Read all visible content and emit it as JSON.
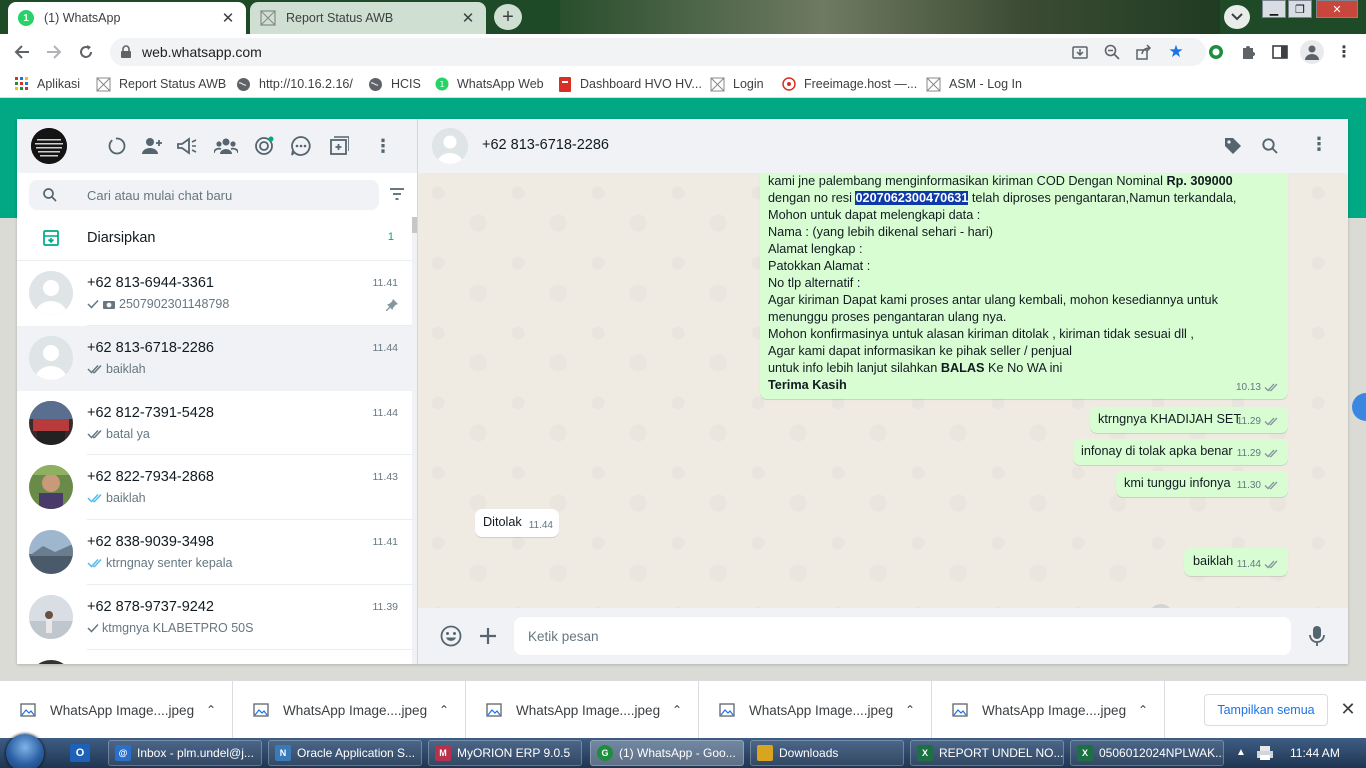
{
  "browser": {
    "tabs": [
      {
        "title": "(1) WhatsApp",
        "badge": "1"
      },
      {
        "title": "Report Status AWB"
      }
    ],
    "url": "web.whatsapp.com",
    "bookmarks": [
      "Aplikasi",
      "Report Status AWB",
      "http://10.16.2.16/",
      "HCIS",
      "WhatsApp Web",
      "Dashboard HVO HV...",
      "Login",
      "Freeimage.host —...",
      "ASM - Log In"
    ]
  },
  "sidebar": {
    "search_placeholder": "Cari atau mulai chat baru",
    "archived_label": "Diarsipkan",
    "archived_count": "1",
    "chats": [
      {
        "name": "+62 813-6944-3361",
        "time": "11.41",
        "preview": "2507902301148798",
        "check": "single",
        "has_photo_icon": true,
        "pinned": true
      },
      {
        "name": "+62 813-6718-2286",
        "time": "11.44",
        "preview": "baiklah",
        "check": "double",
        "selected": true
      },
      {
        "name": "+62 812-7391-5428",
        "time": "11.44",
        "preview": "batal ya",
        "check": "double"
      },
      {
        "name": "+62 822-7934-2868",
        "time": "11.43",
        "preview": "baiklah",
        "check": "double-blue"
      },
      {
        "name": "+62 838-9039-3498",
        "time": "11.41",
        "preview": "ktrngnay senter kepala",
        "check": "double-blue"
      },
      {
        "name": "+62 878-9737-9242",
        "time": "11.39",
        "preview": "ktmgnya KLABETPRO 50S",
        "check": "single"
      }
    ]
  },
  "conversation": {
    "contact": "+62 813-6718-2286",
    "big_message": {
      "line1_prefix": "kami jne palembang menginformasikan kiriman  COD Dengan Nominal ",
      "line1_bold": "Rp. 309000",
      "line2_prefix": "dengan no resi ",
      "line2_highlight": "0207062300470631",
      "line2_suffix": " telah diproses pengantaran,Namun terkandala,",
      "lines": [
        "Mohon untuk dapat melengkapi data :",
        "Nama : (yang lebih dikenal sehari - hari)",
        "Alamat  lengkap :",
        "Patokkan Alamat :",
        "No tlp alternatif :",
        "Agar kiriman Dapat kami proses antar ulang kembali, mohon kesediannya untuk",
        "menunggu proses pengantaran ulang nya.",
        "Mohon konfirmasinya untuk alasan kiriman ditolak , kiriman tidak sesuai dll ,",
        "Agar kami dapat informasikan ke pihak seller / penjual"
      ],
      "line_last_prefix": "untuk info lebih lanjut silahkan ",
      "line_last_bold": "BALAS",
      "line_last_suffix": " Ke No WA ini",
      "closing": "Terima Kasih",
      "time": "10.13"
    },
    "messages": [
      {
        "dir": "out",
        "text": "ktrngnya KHADIJAH SET",
        "time": "11.29"
      },
      {
        "dir": "out",
        "text": "infonay di tolak apka benar",
        "time": "11.29"
      },
      {
        "dir": "out",
        "text": "kmi tunggu infonya",
        "time": "11.30"
      },
      {
        "dir": "in",
        "text": "Ditolak",
        "time": "11.44"
      },
      {
        "dir": "out",
        "text": "baiklah",
        "time": "11.44"
      }
    ],
    "compose_placeholder": "Ketik pesan"
  },
  "downloads": {
    "files": [
      "WhatsApp Image....jpeg",
      "WhatsApp Image....jpeg",
      "WhatsApp Image....jpeg",
      "WhatsApp Image....jpeg",
      "WhatsApp Image....jpeg"
    ],
    "show_all": "Tampilkan semua"
  },
  "taskbar": {
    "items": [
      {
        "label": "Inbox - plm.undel@j...",
        "color": "#2a6fc9",
        "glyph": "@"
      },
      {
        "label": "Oracle Application S...",
        "color": "#3a7ab8",
        "glyph": "N"
      },
      {
        "label": "MyORION ERP 9.0.5",
        "color": "#b8324b",
        "glyph": "M"
      },
      {
        "label": "(1) WhatsApp - Goo...",
        "color": "#1e8e3e",
        "glyph": "G",
        "active": true
      },
      {
        "label": "Downloads",
        "color": "#d9a520",
        "glyph": ""
      },
      {
        "label": "REPORT UNDEL NO...",
        "color": "#1d7044",
        "glyph": "X"
      },
      {
        "label": "0506012024NPLWAK...",
        "color": "#1d7044",
        "glyph": "X"
      }
    ],
    "clock": "11:44 AM"
  },
  "colors": {
    "whatsapp_green": "#00a884",
    "outgoing_bubble": "#d9fdd3",
    "read_tick": "#53bdeb"
  }
}
